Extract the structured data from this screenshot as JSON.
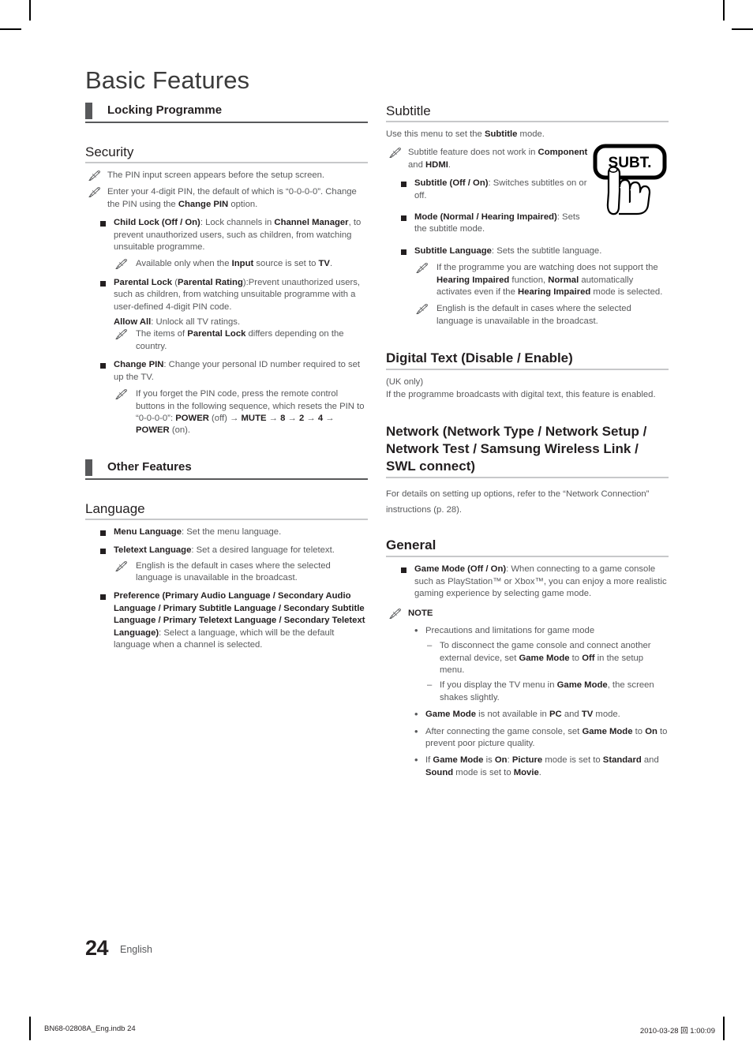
{
  "document": {
    "title": "Basic Features",
    "page_number": "24",
    "language_label": "English",
    "footer_left": "BN68-02808A_Eng.indb   24",
    "footer_right": "2010-03-28   回 1:00:09"
  },
  "figure": {
    "remote_key_label": "SUBT.",
    "name": "subt-remote-key"
  },
  "left_column": {
    "band_locking": "Locking Programme",
    "security": {
      "heading": "Security",
      "note_1": "The PIN input screen appears before the setup screen.",
      "note_2_a": "Enter your 4-digit PIN, the default of which is “0-0-0-0”. Change the PIN using the ",
      "note_2_b": "Change PIN",
      "note_2_c": " option.",
      "child_lock": {
        "term": "Child Lock (Off / On)",
        "text_a": ": Lock channels in ",
        "bold_1": "Channel Manager",
        "text_b": ", to prevent unauthorized users, such as children, from watching unsuitable programme.",
        "note_a": "Available only when the ",
        "note_bold_1": "Input",
        "note_b": " source is set to ",
        "note_bold_2": "TV",
        "note_c": "."
      },
      "parental_lock": {
        "term": "Parental Lock",
        "term_paren_open": " (",
        "term_bold_2": "Parental Rating",
        "text_a": "):Prevent unauthorized users, such as children, from watching unsuitable programme with a user-defined 4-digit PIN code.",
        "allow_all_term": "Allow All",
        "allow_all_text": ": Unlock all TV ratings.",
        "note_a": "The items of ",
        "note_bold": "Parental Lock",
        "note_b": " differs depending on the country."
      },
      "change_pin": {
        "term": "Change PIN",
        "text": ": Change your personal ID number required to set up the TV.",
        "note_a": "If you forget the PIN code, press the remote control buttons in the following sequence, which resets the PIN to “0-0-0-0”: ",
        "note_bold_1": "POWER",
        "note_b": " (off) → ",
        "note_bold_2": "MUTE",
        "note_c": " → ",
        "note_bold_3": "8",
        "note_d": " → ",
        "note_bold_4": "2",
        "note_e": " → ",
        "note_bold_5": "4",
        "note_f": " → ",
        "note_bold_6": "POWER",
        "note_g": " (on)."
      }
    },
    "band_other": "Other Features",
    "language": {
      "heading": "Language",
      "menu_language_term": "Menu Language",
      "menu_language_text": ": Set the menu language.",
      "teletext_term": "Teletext Language",
      "teletext_text": ": Set a desired language for teletext.",
      "teletext_note": "English is the default in cases where the selected language is unavailable in the broadcast.",
      "preference_term": "Preference (Primary Audio Language / Secondary Audio Language / Primary Subtitle Language / Secondary Subtitle Language / Primary Teletext Language / Secondary Teletext Language)",
      "preference_text": ": Select a language, which will be the default language when a channel is selected."
    }
  },
  "right_column": {
    "subtitle": {
      "heading": "Subtitle",
      "intro_a": "Use this menu to set the ",
      "intro_bold": "Subtitle",
      "intro_b": " mode.",
      "note_1_a": "Subtitle feature does not work in ",
      "note_1_bold_1": "Component",
      "note_1_b": " and ",
      "note_1_bold_2": "HDMI",
      "note_1_c": ".",
      "item_1_term": "Subtitle (Off / On)",
      "item_1_text": ": Switches subtitles on or off.",
      "item_2_term": "Mode (Normal / Hearing Impaired)",
      "item_2_text": ": Sets the subtitle mode.",
      "item_3_term": "Subtitle Language",
      "item_3_text": ": Sets the subtitle language.",
      "item_3_note_1_a": "If the programme you are watching does not support the ",
      "item_3_note_1_b1": "Hearing Impaired",
      "item_3_note_1_b": " function, ",
      "item_3_note_1_b2": "Normal",
      "item_3_note_1_c": " automatically activates even if the ",
      "item_3_note_1_b3": "Hearing Impaired",
      "item_3_note_1_d": " mode is selected.",
      "item_3_note_2": "English is the default in cases where the selected language is unavailable in the broadcast."
    },
    "digital_text": {
      "heading": "Digital Text (Disable / Enable)",
      "line_1": "(UK only)",
      "line_2": "If the programme broadcasts with digital text, this feature is enabled."
    },
    "network": {
      "heading": "Network (Network Type / Network Setup / Network Test / Samsung Wireless Link / SWL connect)",
      "body": "For details on setting up options, refer to the “Network Connection” instructions (p. 28)."
    },
    "general": {
      "heading": "General",
      "game_mode_term": "Game Mode (Off / On)",
      "game_mode_text": ": When connecting to a game console such as PlayStation™ or Xbox™, you can enjoy a more realistic gaming experience by selecting game mode.",
      "note_label": "NOTE",
      "note_1": "Precautions and limitations for game mode",
      "note_1_sub_1_a": "To disconnect the game console and connect another external device, set ",
      "note_1_sub_1_b1": "Game Mode",
      "note_1_sub_1_b": " to ",
      "note_1_sub_1_b2": "Off",
      "note_1_sub_1_c": " in the setup menu.",
      "note_1_sub_2_a": "If you display the TV menu in ",
      "note_1_sub_2_b1": "Game Mode",
      "note_1_sub_2_b": ", the screen shakes slightly.",
      "note_2_b1": "Game Mode",
      "note_2_a": " is not available in ",
      "note_2_b2": "PC",
      "note_2_b": " and ",
      "note_2_b3": "TV",
      "note_2_c": " mode.",
      "note_3_a": "After connecting the game console, set ",
      "note_3_b1": "Game Mode",
      "note_3_b": " to ",
      "note_3_b2": "On",
      "note_3_c": " to prevent poor picture quality.",
      "note_4_a": "If ",
      "note_4_b1": "Game Mode",
      "note_4_b": " is ",
      "note_4_b2": "On",
      "note_4_c": ": ",
      "note_4_b3": "Picture",
      "note_4_d": " mode is set to ",
      "note_4_b4": "Standard",
      "note_4_e": " and ",
      "note_4_b5": "Sound",
      "note_4_f": " mode is set to ",
      "note_4_b6": "Movie",
      "note_4_g": "."
    }
  },
  "colors": {
    "band_gray": "#58595b",
    "rule_gray": "#c7c8ca",
    "body_text": "#58595b",
    "bold_text": "#231f20"
  }
}
